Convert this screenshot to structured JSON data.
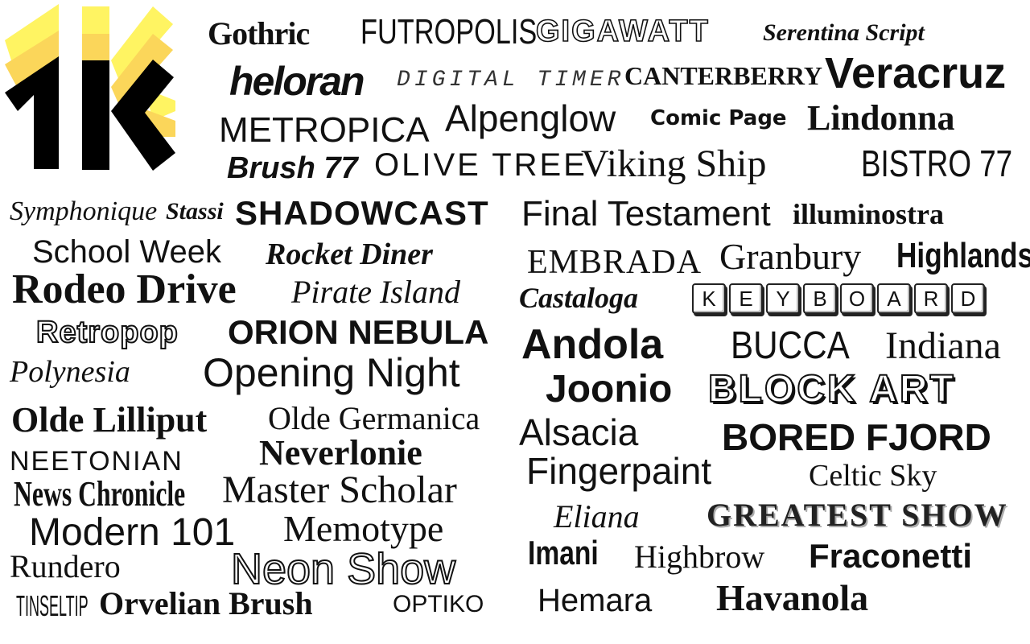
{
  "logo": {
    "text": "1K",
    "colors": {
      "black": "#000000",
      "gold": "#fbd65a",
      "yellow": "#fff462"
    }
  },
  "fonts": [
    "Gothric",
    "FUTROPOLIS",
    "GIGAWATT",
    "Serentina Script",
    "heloran",
    "DIGITAL TIMER",
    "CANTERBERRY",
    "Veracruz",
    "METROPICA",
    "Alpenglow",
    "Comic Page",
    "Lindonna",
    "Brush 77",
    "OLIVE TREE",
    "Viking Ship",
    "BISTRO 77",
    "Symphonique",
    "Stassi",
    "SHADOWCAST",
    "Final Testament",
    "illuminostra",
    "School Week",
    "Rocket Diner",
    "EMBRADA",
    "Granbury",
    "Highlands",
    "Rodeo Drive",
    "Pirate Island",
    "Castaloga",
    "KEYBOARD",
    "Retropop",
    "ORION NEBULA",
    "Andola",
    "BUCCA",
    "Indiana",
    "Polynesia",
    "Opening Night",
    "Joonio",
    "BLOCK ART",
    "Olde Lilliput",
    "Olde Germanica",
    "Alsacia",
    "BORED FJORD",
    "NEETONIAN",
    "Neverlonie",
    "Fingerpaint",
    "Celtic Sky",
    "News Chronicle",
    "Master Scholar",
    "Eliana",
    "GREATEST SHOW",
    "Modern 101",
    "Memotype",
    "Imani",
    "Highbrow",
    "Fraconetti",
    "Rundero",
    "Neon Show",
    "Hemara",
    "Havanola",
    "TINSELTIP",
    "Orvelian Brush",
    "OPTIKO"
  ],
  "keyboard_keys": [
    "K",
    "E",
    "Y",
    "B",
    "O",
    "A",
    "R",
    "D"
  ]
}
